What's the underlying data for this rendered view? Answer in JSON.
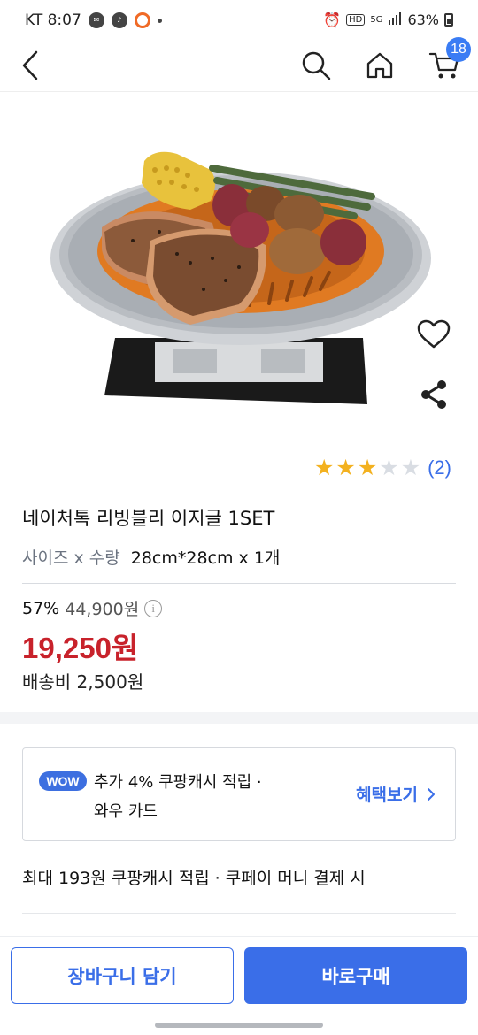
{
  "status_bar": {
    "carrier_time": "KT 8:07",
    "network": "5G",
    "battery": "63%"
  },
  "nav": {
    "cart_count": "18"
  },
  "product": {
    "rating_count": "(2)",
    "rating_value": 3,
    "rating_max": 5,
    "title": "네이처톡 리빙블리 이지글 1SET",
    "option_label": "사이즈 x 수량",
    "option_value": "28cm*28cm x 1개",
    "discount_rate": "57%",
    "original_price": "44,900원",
    "sale_price": "19,250원",
    "shipping": "배송비 2,500원"
  },
  "benefit": {
    "badge": "WOW",
    "line1": "추가 4% 쿠팡캐시 적립  ·",
    "line2": "와우 카드",
    "link": "혜택보기"
  },
  "cash": {
    "prefix": "최대 193원",
    "link": "쿠팡캐시 적립",
    "suffix": "· 쿠페이 머니 결제 시"
  },
  "actions": {
    "add_to_cart": "장바구니 담기",
    "buy_now": "바로구매"
  },
  "colors": {
    "accent": "#3a6ee8",
    "price": "#c8222b",
    "star": "#f3b11f"
  }
}
